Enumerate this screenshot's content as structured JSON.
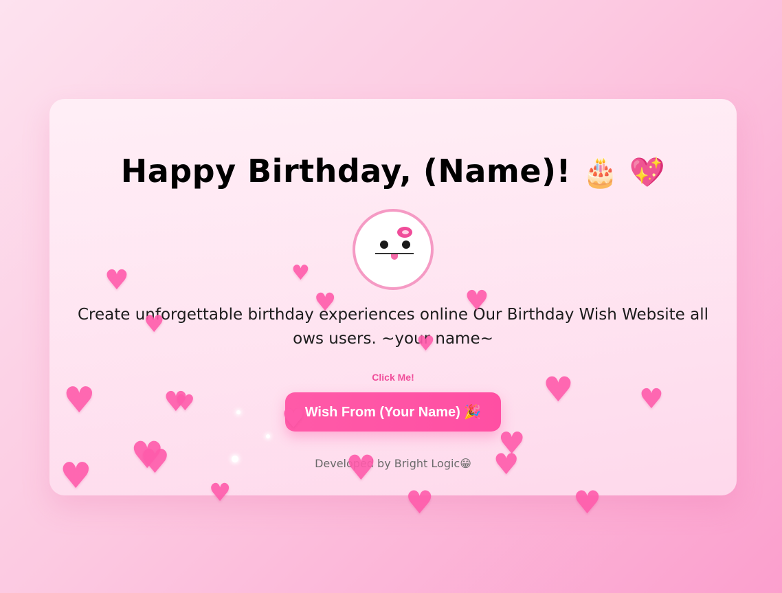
{
  "card": {
    "title": "Happy Birthday, (Name)!",
    "title_emojis": "🎂 💖",
    "message": "Create unforgettable birthday experiences online Our Birthday Wish Website allows users. ~your name~",
    "hint": "Click Me!",
    "button_label": "Wish From (Your Name) 🎉",
    "footer": "Developed by Bright Logic😁"
  },
  "decor": {
    "heart_glyph": "♥",
    "avatar_icon": "kitty-face-icon"
  },
  "colors": {
    "accent": "#ff4fa3",
    "avatar_border": "#f59ac4",
    "heart": "#ff5bab"
  }
}
